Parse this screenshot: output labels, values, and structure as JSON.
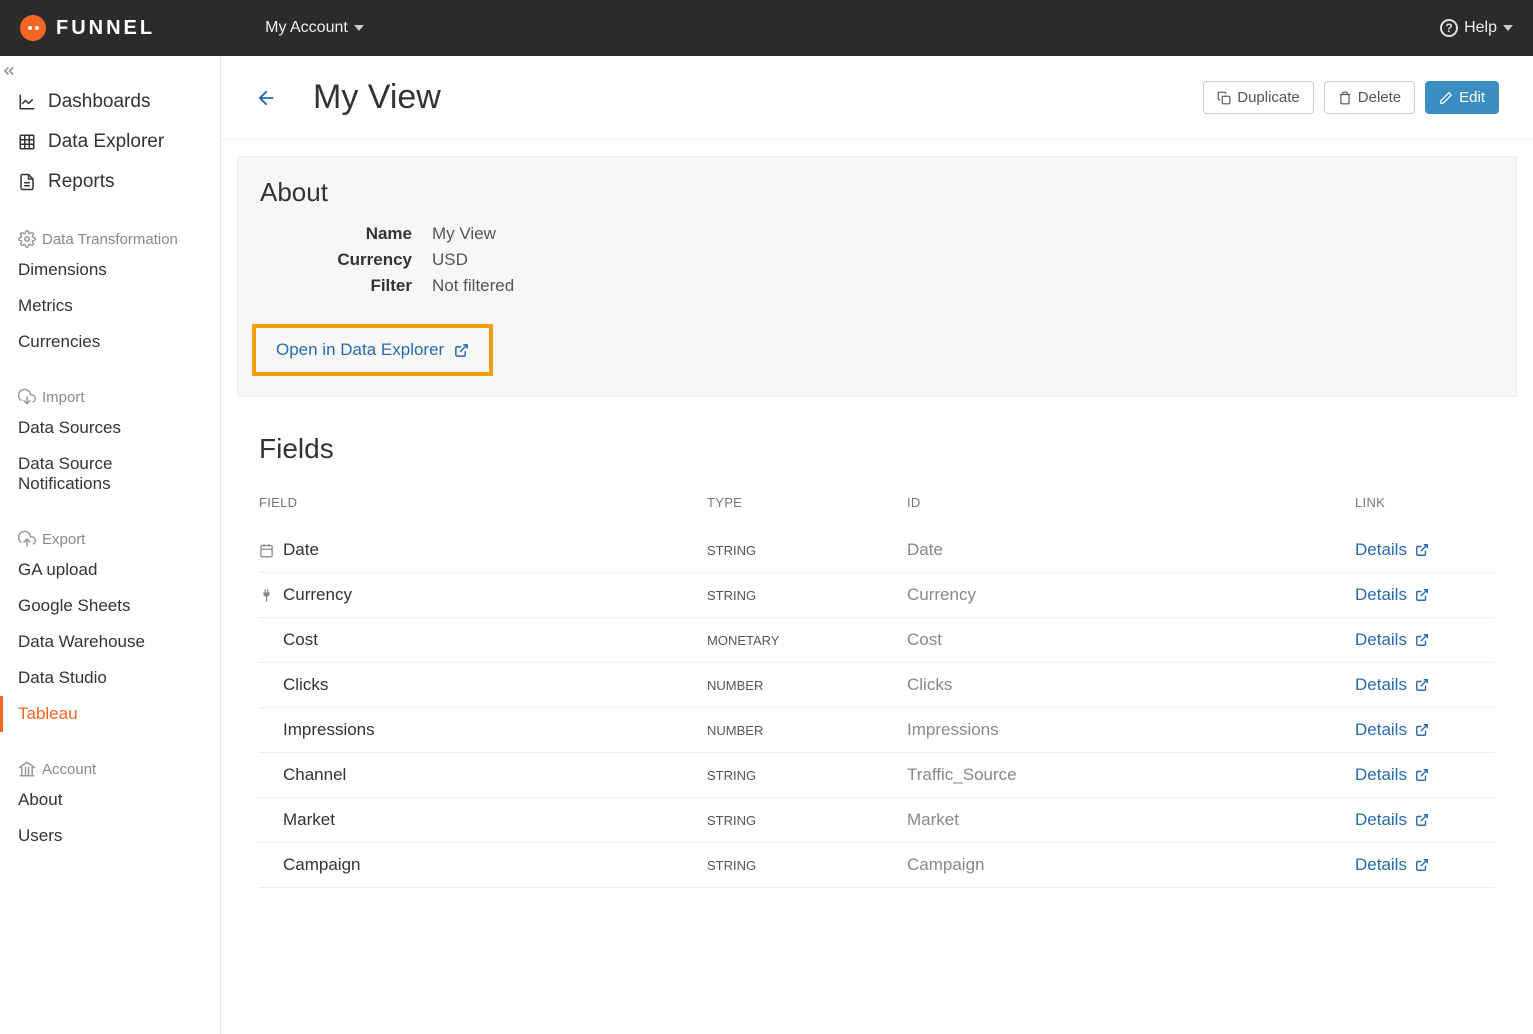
{
  "topnav": {
    "brand_logo": "funnel-logo",
    "brand_text": "FUNNEL",
    "account_label": "My Account",
    "help_label": "Help"
  },
  "sidebar": {
    "primary": [
      {
        "icon": "chart-line-icon",
        "label": "Dashboards"
      },
      {
        "icon": "grid-icon",
        "label": "Data Explorer"
      },
      {
        "icon": "file-icon",
        "label": "Reports"
      }
    ],
    "sections": [
      {
        "icon": "gear-icon",
        "title": "Data Transformation",
        "items": [
          "Dimensions",
          "Metrics",
          "Currencies"
        ]
      },
      {
        "icon": "cloud-download-icon",
        "title": "Import",
        "items": [
          "Data Sources",
          "Data Source Notifications"
        ]
      },
      {
        "icon": "cloud-upload-icon",
        "title": "Export",
        "items": [
          "GA upload",
          "Google Sheets",
          "Data Warehouse",
          "Data Studio",
          "Tableau"
        ],
        "active_index": 4
      },
      {
        "icon": "bank-icon",
        "title": "Account",
        "items": [
          "About",
          "Users"
        ]
      }
    ]
  },
  "page": {
    "title": "My View",
    "buttons": {
      "duplicate": "Duplicate",
      "delete": "Delete",
      "edit": "Edit"
    },
    "about": {
      "heading": "About",
      "rows": [
        {
          "label": "Name",
          "value": "My View"
        },
        {
          "label": "Currency",
          "value": "USD"
        },
        {
          "label": "Filter",
          "value": "Not filtered"
        }
      ],
      "open_link": "Open in Data Explorer"
    },
    "fields": {
      "heading": "Fields",
      "columns": {
        "field": "FIELD",
        "type": "TYPE",
        "id": "ID",
        "link": "LINK"
      },
      "details_label": "Details",
      "rows": [
        {
          "icon": "calendar-icon",
          "name": "Date",
          "type": "STRING",
          "id": "Date"
        },
        {
          "icon": "plug-icon",
          "name": "Currency",
          "type": "STRING",
          "id": "Currency"
        },
        {
          "icon": "",
          "name": "Cost",
          "type": "MONETARY",
          "id": "Cost"
        },
        {
          "icon": "",
          "name": "Clicks",
          "type": "NUMBER",
          "id": "Clicks"
        },
        {
          "icon": "",
          "name": "Impressions",
          "type": "NUMBER",
          "id": "Impressions"
        },
        {
          "icon": "",
          "name": "Channel",
          "type": "STRING",
          "id": "Traffic_Source"
        },
        {
          "icon": "",
          "name": "Market",
          "type": "STRING",
          "id": "Market"
        },
        {
          "icon": "",
          "name": "Campaign",
          "type": "STRING",
          "id": "Campaign"
        }
      ]
    }
  }
}
